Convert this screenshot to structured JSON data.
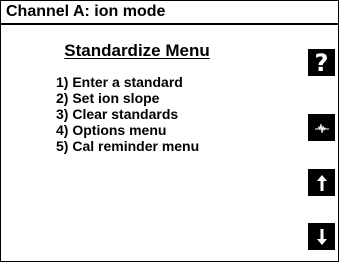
{
  "header": {
    "title": "Channel A: ion mode"
  },
  "menu": {
    "title": "Standardize Menu",
    "items": [
      {
        "label": "1) Enter a standard"
      },
      {
        "label": "2) Set ion slope"
      },
      {
        "label": "3) Clear standards"
      },
      {
        "label": "4) Options menu"
      },
      {
        "label": "5) Cal reminder menu"
      }
    ]
  },
  "softkeys": {
    "help_label": "?",
    "icons": [
      "help-icon",
      "probe-icon",
      "arrow-up-icon",
      "arrow-down-icon"
    ]
  },
  "colors": {
    "background": "#ffffff",
    "foreground": "#000000"
  }
}
